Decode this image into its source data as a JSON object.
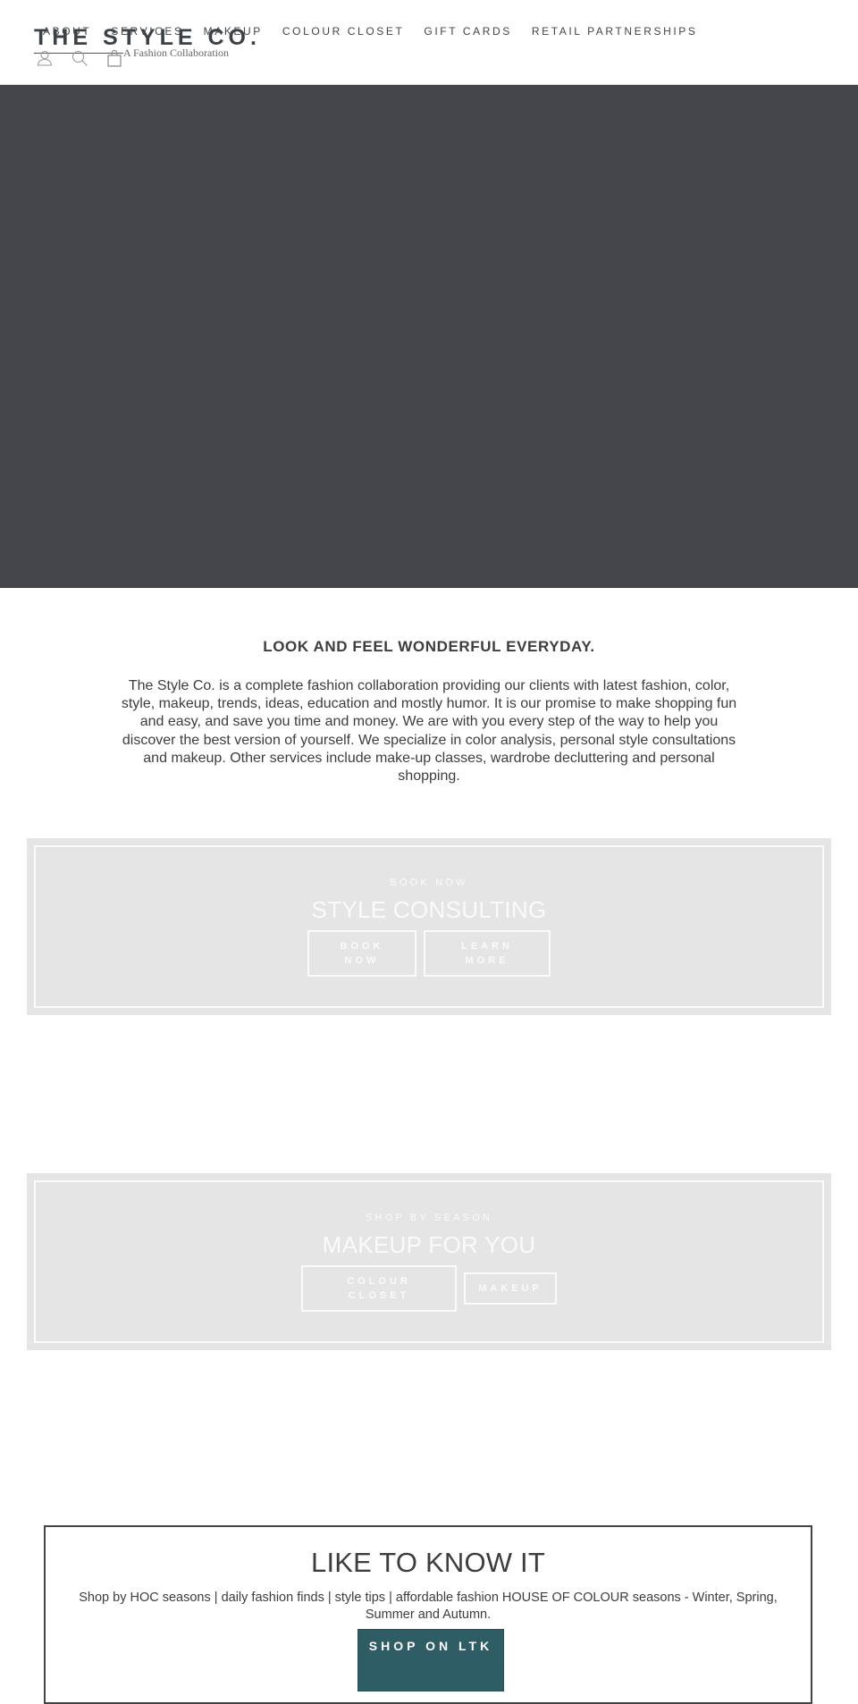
{
  "header": {
    "logo": {
      "title": "THE STYLE CO.",
      "subtitle": "A Fashion Collaboration"
    },
    "nav": [
      {
        "label": "ABOUT"
      },
      {
        "label": "SERVICES"
      },
      {
        "label": "MAKEUP"
      },
      {
        "label": "COLOUR CLOSET"
      },
      {
        "label": "GIFT CARDS"
      },
      {
        "label": "RETAIL PARTNERSHIPS"
      }
    ],
    "icons": [
      "account-icon",
      "search-icon",
      "cart-icon"
    ]
  },
  "hero": {
    "background_color": "#45464b"
  },
  "intro": {
    "title": "LOOK AND FEEL WONDERFUL EVERYDAY.",
    "body": "The Style Co. is a complete fashion collaboration providing our clients with latest fashion, color, style, makeup, trends, ideas, education and mostly humor. It is our promise to make shopping fun and easy, and save you time and money. We are with you every step of the way to help you discover the best version of yourself. We specialize in color analysis, personal style consultations and makeup. Other services include make-up classes, wardrobe decluttering and personal shopping."
  },
  "promos": [
    {
      "kicker": "BOOK NOW",
      "heading": "STYLE CONSULTING",
      "buttons": [
        {
          "label": "BOOK NOW"
        },
        {
          "label": "LEARN MORE"
        }
      ]
    },
    {
      "kicker": "SHOP BY SEASON",
      "heading": "MAKEUP FOR YOU",
      "buttons": [
        {
          "label": "COLOUR CLOSET"
        },
        {
          "label": "MAKEUP"
        }
      ]
    }
  ],
  "ltk": {
    "title": "LIKE TO KNOW IT",
    "description": "Shop by HOC seasons | daily fashion finds | style tips | affordable fashion HOUSE OF COLOUR seasons - Winter, Spring, Summer and Autumn.",
    "button_label": "SHOP ON LTK",
    "button_color": "#2e5d66"
  }
}
